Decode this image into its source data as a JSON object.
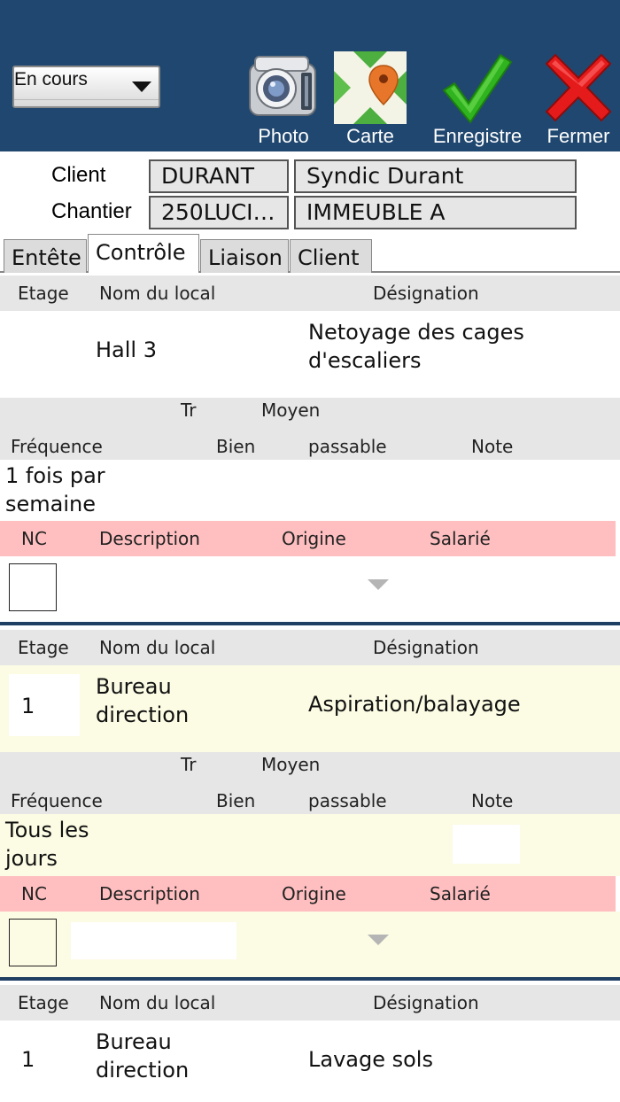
{
  "toolbar": {
    "status_value": "En cours",
    "photo_label": "Photo",
    "map_label": "Carte",
    "save_label": "Enregistre",
    "close_label": "Fermer",
    "bg_color": "#20476f"
  },
  "header": {
    "client_label": "Client",
    "client_code": "DURANT",
    "client_name": "Syndic Durant",
    "site_label": "Chantier",
    "site_code": "250LUCI…",
    "site_name": "IMMEUBLE A"
  },
  "tabs": [
    {
      "label": "Entête",
      "active": false
    },
    {
      "label": "Contrôle",
      "active": true
    },
    {
      "label": "Liaison",
      "active": false
    },
    {
      "label": "Client",
      "active": false
    }
  ],
  "columns": {
    "etage": "Etage",
    "nom_local": "Nom du local",
    "designation": "Désignation",
    "tr": "Tr",
    "moyen": "Moyen",
    "frequence": "Fréquence",
    "bien": "Bien",
    "passable": "passable",
    "note": "Note",
    "nc": "NC",
    "description": "Description",
    "origine": "Origine",
    "salarie": "Salarié"
  },
  "records": [
    {
      "etage": "",
      "local_line1": "Hall 3",
      "local_line2": "",
      "designation_line1": "Netoyage des cages",
      "designation_line2": "d'escaliers",
      "freq_line1": "1 fois par",
      "freq_line2": "semaine"
    },
    {
      "etage": "1",
      "local_line1": "Bureau",
      "local_line2": "direction",
      "designation_line1": "Aspiration/balayage",
      "designation_line2": "",
      "freq_line1": "Tous les",
      "freq_line2": "jours"
    },
    {
      "etage": "1",
      "local_line1": "Bureau",
      "local_line2": "direction",
      "designation_line1": "Lavage sols",
      "designation_line2": ""
    }
  ],
  "colors": {
    "header_row": "#e6e6e6",
    "nc_row": "#ffbfc0",
    "highlight_row": "#fcfbe3",
    "divider": "#1f3f63"
  },
  "icons": [
    "camera-icon",
    "map-pin-icon",
    "checkmark-icon",
    "close-x-icon",
    "chevron-down-icon"
  ]
}
